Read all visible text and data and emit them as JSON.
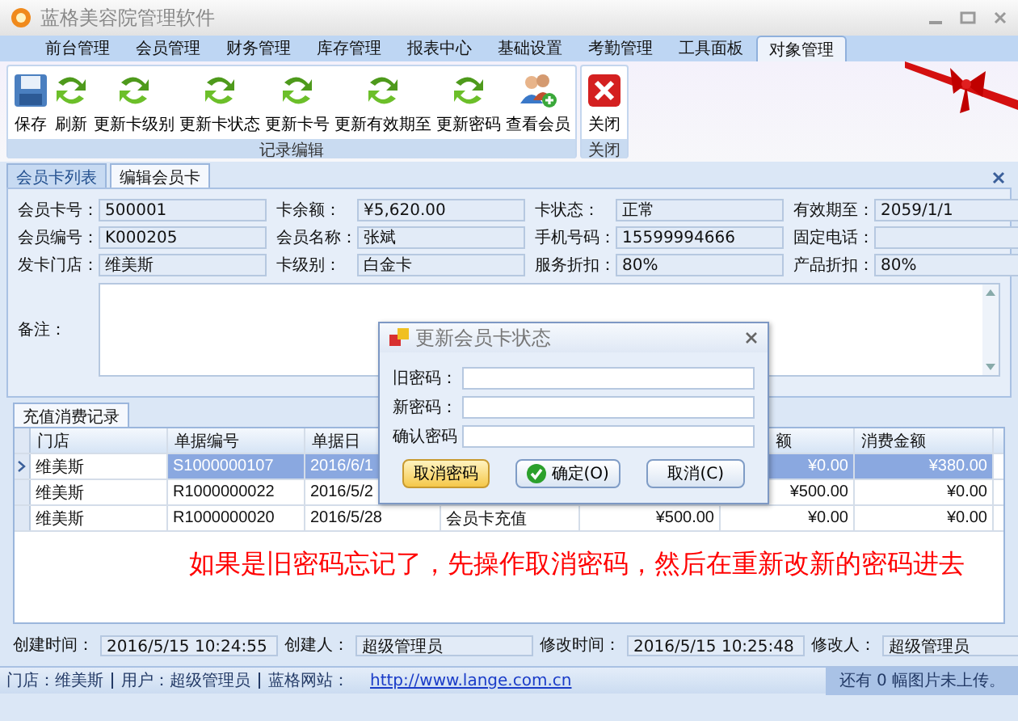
{
  "window": {
    "title": "蓝格美容院管理软件"
  },
  "menu_tabs": [
    {
      "label": "前台管理",
      "selected": false
    },
    {
      "label": "会员管理",
      "selected": false
    },
    {
      "label": "财务管理",
      "selected": false
    },
    {
      "label": "库存管理",
      "selected": false
    },
    {
      "label": "报表中心",
      "selected": false
    },
    {
      "label": "基础设置",
      "selected": false
    },
    {
      "label": "考勤管理",
      "selected": false
    },
    {
      "label": "工具面板",
      "selected": false
    },
    {
      "label": "对象管理",
      "selected": true
    }
  ],
  "ribbon": [
    {
      "caption": "记录编辑",
      "buttons": [
        {
          "label": "保存",
          "kind": "save"
        },
        {
          "label": "刷新",
          "kind": "refresh"
        },
        {
          "label": "更新卡级别",
          "kind": "refresh"
        },
        {
          "label": "更新卡状态",
          "kind": "refresh"
        },
        {
          "label": "更新卡号",
          "kind": "refresh"
        },
        {
          "label": "更新有效期至",
          "kind": "refresh"
        },
        {
          "label": "更新密码",
          "kind": "refresh"
        },
        {
          "label": "查看会员",
          "kind": "people"
        }
      ]
    },
    {
      "caption": "关闭",
      "buttons": [
        {
          "label": "关闭",
          "kind": "close"
        }
      ]
    }
  ],
  "doc_tabs": [
    {
      "label": "会员卡列表",
      "selected": false
    },
    {
      "label": "编辑会员卡",
      "selected": true
    }
  ],
  "card_form": {
    "fields": [
      {
        "label": "会员卡号：",
        "value": "500001"
      },
      {
        "label": "卡余额：",
        "value": "¥5,620.00"
      },
      {
        "label": "卡状态：",
        "value": "正常"
      },
      {
        "label": "有效期至：",
        "value": "2059/1/1"
      },
      {
        "label": "会员编号：",
        "value": "K000205"
      },
      {
        "label": "会员名称：",
        "value": "张斌"
      },
      {
        "label": "手机号码：",
        "value": "15599994666"
      },
      {
        "label": "固定电话："
      },
      {
        "label": "发卡门店：",
        "value": "维美斯"
      },
      {
        "label": "卡级别：",
        "value": "白金卡"
      },
      {
        "label": "服务折扣：",
        "value": "80%"
      },
      {
        "label": "产品折扣：",
        "value": "80%"
      }
    ],
    "remark_label": "备注："
  },
  "records": {
    "tab": "充值消费记录",
    "columns": [
      "门店",
      "单据编号",
      "单据日",
      null,
      null,
      "额",
      "消费金额"
    ],
    "rows": [
      {
        "selected": true,
        "cells": [
          "维美斯",
          "S1000000107",
          "2016/6/1",
          null,
          null,
          "¥0.00",
          "¥380.00"
        ]
      },
      {
        "selected": false,
        "cells": [
          "维美斯",
          "R1000000022",
          "2016/5/2",
          null,
          null,
          "¥500.00",
          "¥0.00"
        ]
      },
      {
        "selected": false,
        "cells": [
          "维美斯",
          "R1000000020",
          "2016/5/28",
          "会员卡充值",
          "¥500.00",
          "¥0.00",
          "¥0.00"
        ]
      }
    ],
    "note": "如果是旧密码忘记了，先操作取消密码，然后在重新改新的密码进去"
  },
  "audit": [
    {
      "label": "创建时间：",
      "value": "2016/5/15 10:24:55"
    },
    {
      "label": "创建人：",
      "value": "超级管理员"
    },
    {
      "label": "修改时间：",
      "value": "2016/5/15 10:25:48"
    },
    {
      "label": "修改人：",
      "value": "超级管理员"
    }
  ],
  "status_bar": {
    "store": "门店：维美斯",
    "user": "用户：超级管理员",
    "site_label": "蓝格网站：",
    "site_link": "http://www.lange.com.cn",
    "upload": "还有 0 幅图片未上传。"
  },
  "dialog": {
    "title": "更新会员卡状态",
    "fields": [
      {
        "label": "旧密码："
      },
      {
        "label": "新密码："
      },
      {
        "label": "确认密码"
      }
    ],
    "buttons": [
      {
        "label": "取消密码",
        "kind": "highlight"
      },
      {
        "label": "确定(O)",
        "kind": "ok"
      },
      {
        "label": "取消(C)",
        "kind": "plain"
      }
    ]
  }
}
